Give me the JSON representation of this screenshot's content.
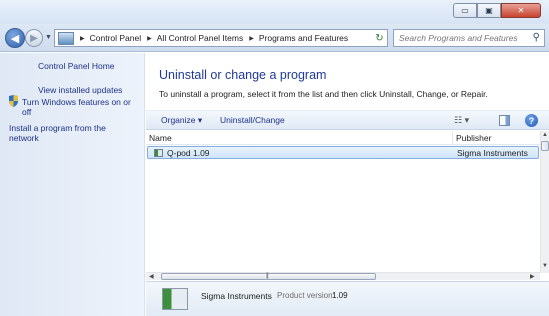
{
  "window": {
    "minimize": "▭",
    "maximize": "▣",
    "close": "✕"
  },
  "nav": {
    "breadcrumbs": [
      "Control Panel",
      "All Control Panel Items",
      "Programs and Features"
    ],
    "search_placeholder": "Search Programs and Features"
  },
  "sidebar": {
    "items": [
      {
        "label": "Control Panel Home"
      },
      {
        "label": "View installed updates"
      },
      {
        "label": "Turn Windows features on or off"
      },
      {
        "label": "Install a program from the network"
      }
    ]
  },
  "main": {
    "title": "Uninstall or change a program",
    "description": "To uninstall a program, select it from the list and then click Uninstall, Change, or Repair."
  },
  "toolbar": {
    "organize": "Organize ▾",
    "uninstall_change": "Uninstall/Change",
    "help": "?"
  },
  "table": {
    "columns": [
      "Name",
      "Publisher"
    ],
    "rows": [
      {
        "name": "Q-pod 1.09",
        "publisher": "Sigma Instruments"
      }
    ]
  },
  "details": {
    "publisher": "Sigma Instruments",
    "version_label": "Product version:",
    "version": "1.09"
  }
}
